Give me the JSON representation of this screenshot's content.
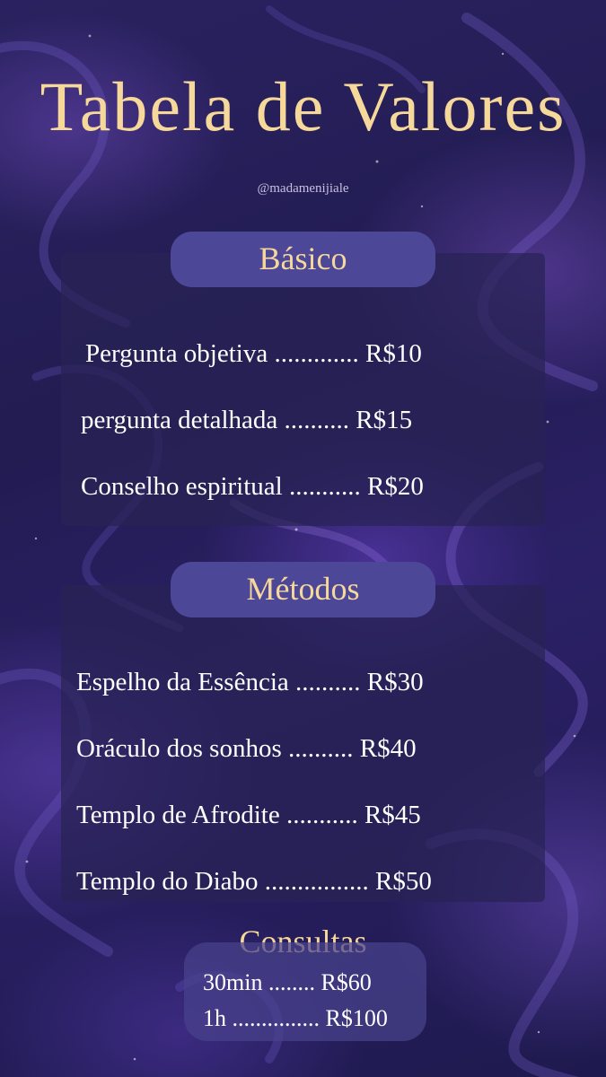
{
  "title": "Tabela de Valores",
  "handle": "@madamenijiale",
  "colors": {
    "accent_gold": "#f6d89a",
    "pill": "#4c4796",
    "panel": "#282254",
    "background": "#221c52"
  },
  "sections": {
    "basico": {
      "label": "Básico",
      "items": [
        {
          "text": "Pergunta objetiva ............. R$10"
        },
        {
          "text": "pergunta detalhada .......... R$15"
        },
        {
          "text": "Conselho espiritual ........... R$20"
        }
      ]
    },
    "metodos": {
      "label": "Métodos",
      "items": [
        {
          "text": "Espelho da Essência .......... R$30"
        },
        {
          "text": "Oráculo dos sonhos .......... R$40"
        },
        {
          "text": "Templo de Afrodite ........... R$45"
        },
        {
          "text": "Templo do Diabo ................ R$50"
        }
      ]
    },
    "consultas": {
      "label": "Consultas",
      "items": [
        {
          "text": "30min ........ R$60"
        },
        {
          "text": "1h ............... R$100"
        }
      ]
    }
  }
}
